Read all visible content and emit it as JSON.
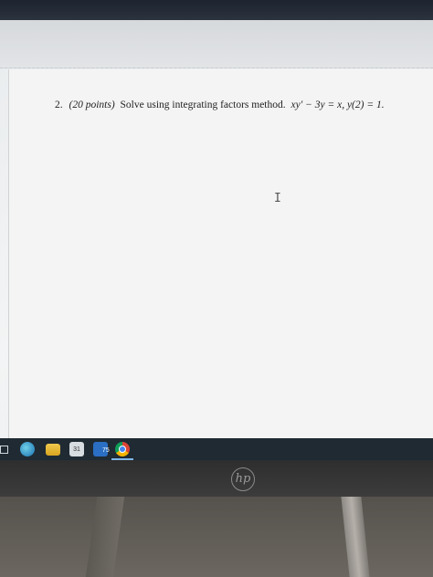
{
  "document": {
    "question_number": "2.",
    "points": "(20 points)",
    "prompt": "Solve using integrating factors method.",
    "equation": "xy′ − 3y = x, y(2) = 1."
  },
  "taskbar": {
    "icons": [
      "task-view-icon",
      "edge-icon",
      "file-explorer-icon",
      "calendar-icon",
      "mail-icon",
      "chrome-icon"
    ],
    "calendar_text": "31",
    "mail_badge": "75"
  },
  "monitor": {
    "brand_logo": "hp"
  }
}
